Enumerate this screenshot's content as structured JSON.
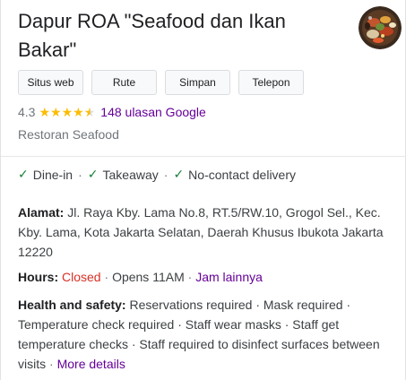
{
  "business": {
    "name": "Dapur ROA \"Seafood dan Ikan Bakar\"",
    "rating": "4.3",
    "reviews_link": "148 ulasan Google",
    "category": "Restoran Seafood"
  },
  "actions": [
    "Situs web",
    "Rute",
    "Simpan",
    "Telepon"
  ],
  "services": [
    "Dine-in",
    "Takeaway",
    "No-contact delivery"
  ],
  "address": {
    "label": "Alamat:",
    "value": "Jl. Raya Kby. Lama No.8, RT.5/RW.10, Grogol Sel., Kec. Kby. Lama, Kota Jakarta Selatan, Daerah Khusus Ibukota Jakarta 12220"
  },
  "hours": {
    "label": "Hours:",
    "status": "Closed",
    "opens": "Opens 11AM",
    "more_link": "Jam lainnya"
  },
  "health": {
    "label": "Health and safety:",
    "text": "Reservations required · Mask required · Temperature check required · Staff wear masks · Staff get temperature checks · Staff required to disinfect surfaces between visits",
    "more_link": "More details"
  },
  "colors": {
    "star": "#fbbc04",
    "closed": "#d93025",
    "link": "#660099",
    "check": "#188038"
  },
  "icons": {
    "thumbnail": "food-photo",
    "check": "check-icon",
    "star": "star-icon"
  }
}
